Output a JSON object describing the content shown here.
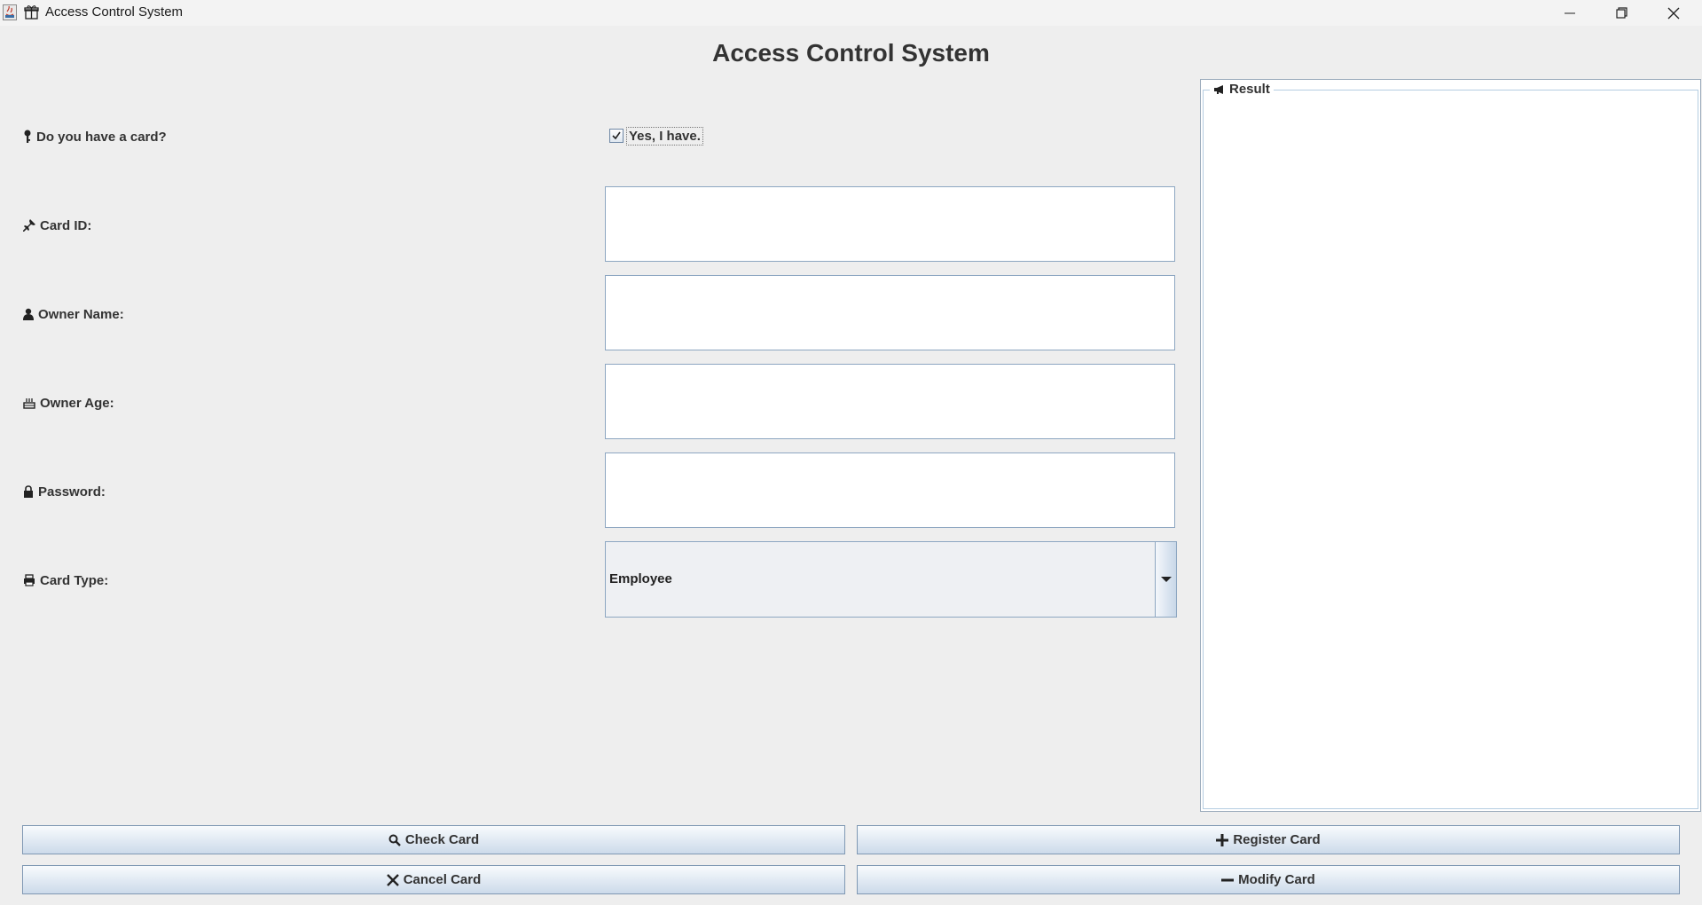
{
  "window": {
    "title": "Access Control System",
    "controls": [
      "minimize-icon",
      "restore-icon",
      "close-icon"
    ]
  },
  "heading": "Access Control System",
  "form": {
    "has_card": {
      "label": "Do you have a card?",
      "icon": "key-icon",
      "checkbox_label": "Yes, I have.",
      "checked": true
    },
    "card_id": {
      "label": "Card ID:",
      "icon": "pin-icon",
      "value": ""
    },
    "owner_name": {
      "label": "Owner Name:",
      "icon": "person-icon",
      "value": ""
    },
    "owner_age": {
      "label": "Owner Age:",
      "icon": "cake-icon",
      "value": ""
    },
    "password": {
      "label": "Password:",
      "icon": "lock-icon",
      "value": ""
    },
    "card_type": {
      "label": "Card Type:",
      "icon": "printer-icon",
      "selected": "Employee"
    }
  },
  "result": {
    "title": "Result",
    "icon": "megaphone-icon",
    "content": ""
  },
  "buttons": {
    "check": {
      "label": "Check Card",
      "icon": "search-icon"
    },
    "register": {
      "label": "Register Card",
      "icon": "plus-icon"
    },
    "cancel": {
      "label": "Cancel Card",
      "icon": "x-icon"
    },
    "modify": {
      "label": "Modify Card",
      "icon": "minus-icon"
    }
  }
}
